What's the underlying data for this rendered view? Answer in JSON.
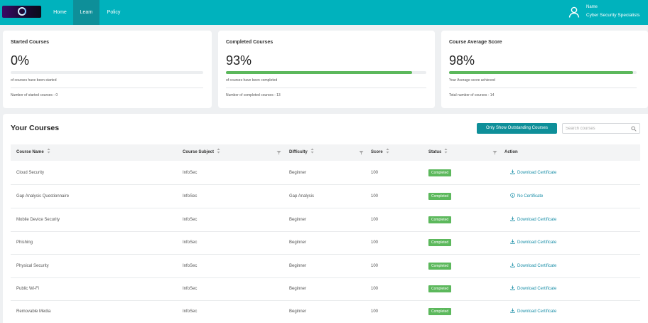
{
  "nav": {
    "items": [
      {
        "label": "Home"
      },
      {
        "label": "Learn"
      },
      {
        "label": "Policy"
      }
    ],
    "user_name": "Name",
    "user_org": "Cyber Security Specialists"
  },
  "stats": [
    {
      "title": "Started Courses",
      "value": "0%",
      "progress": 0,
      "subtitle": "of courses have been started",
      "footer": "Number of started courses - 0"
    },
    {
      "title": "Completed Courses",
      "value": "93%",
      "progress": 0.93,
      "subtitle": "of courses have been completed",
      "footer": "Number of completed courses - 13"
    },
    {
      "title": "Course Average Score",
      "value": "98%",
      "progress": 0.98,
      "subtitle": "Your Average score achieved",
      "footer": "Total number of courses - 14"
    }
  ],
  "courses": {
    "title": "Your Courses",
    "outstanding_button": "Only Show Outstanding Courses",
    "search_placeholder": "Search courses",
    "columns": [
      "Course Name",
      "Course Subject",
      "Difficulty",
      "Score",
      "Status",
      "Action"
    ],
    "rows": [
      {
        "name": "Cloud Security",
        "subject": "InfoSec",
        "difficulty": "Beginner",
        "score": "100",
        "status": "Completed",
        "action": "Download Certificate",
        "action_icon": "download-icon"
      },
      {
        "name": "Gap Analysis Questionnaire",
        "subject": "InfoSec",
        "difficulty": "Gap Analysis",
        "score": "100",
        "status": "Completed",
        "action": "No Certificate",
        "action_icon": "info-icon"
      },
      {
        "name": "Mobile Device Security",
        "subject": "InfoSec",
        "difficulty": "Beginner",
        "score": "100",
        "status": "Completed",
        "action": "Download Certificate",
        "action_icon": "download-icon"
      },
      {
        "name": "Phishing",
        "subject": "InfoSec",
        "difficulty": "Beginner",
        "score": "100",
        "status": "Completed",
        "action": "Download Certificate",
        "action_icon": "download-icon"
      },
      {
        "name": "Physical Security",
        "subject": "InfoSec",
        "difficulty": "Beginner",
        "score": "100",
        "status": "Completed",
        "action": "Download Certificate",
        "action_icon": "download-icon"
      },
      {
        "name": "Public Wi-Fi",
        "subject": "InfoSec",
        "difficulty": "Beginner",
        "score": "100",
        "status": "Completed",
        "action": "Download Certificate",
        "action_icon": "download-icon"
      },
      {
        "name": "Removable Media",
        "subject": "InfoSec",
        "difficulty": "Beginner",
        "score": "100",
        "status": "Completed",
        "action": "Download Certificate",
        "action_icon": "download-icon"
      }
    ]
  },
  "colors": {
    "header": "#00b2bd",
    "active_nav": "#0e8f99",
    "success": "#5cb85c",
    "link": "#1b8fa8"
  }
}
